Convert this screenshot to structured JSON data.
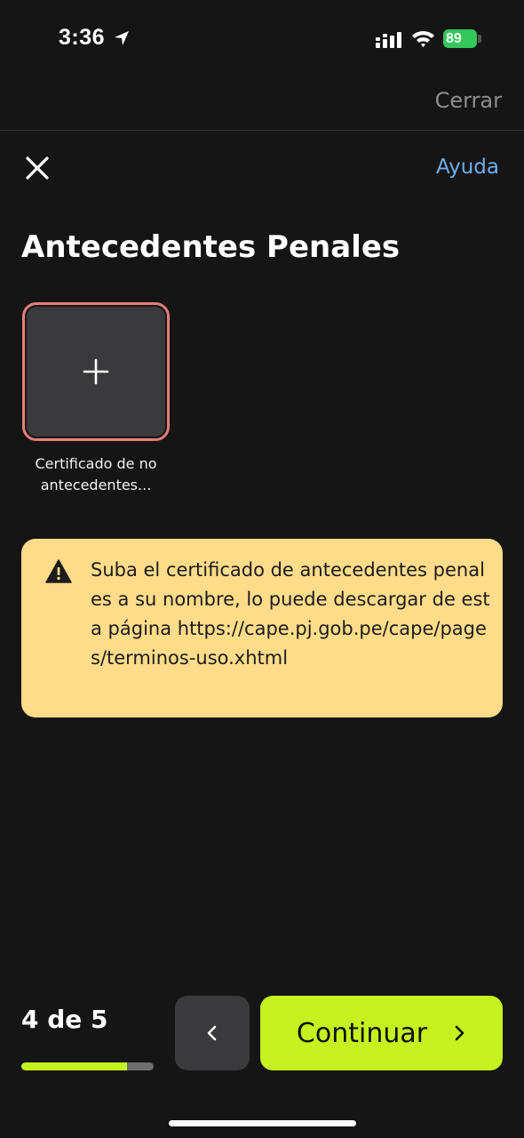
{
  "status_bar": {
    "time": "3:36",
    "battery_level": "89",
    "battery_color": "#34c759",
    "icons": [
      "location-arrow-icon",
      "signal-icon",
      "wifi-icon",
      "battery-icon"
    ]
  },
  "header": {
    "close_label": "Cerrar"
  },
  "nav": {
    "dismiss_icon": "x-icon",
    "help_label": "Ayuda",
    "help_color": "#6eaee8"
  },
  "page": {
    "title": "Antecedentes Penales"
  },
  "upload": {
    "icon": "plus-icon",
    "caption_line1": "Certificado de no",
    "caption_line2": "antecedentes...",
    "border_color": "#e97d7d"
  },
  "warning": {
    "icon": "warning-triangle-icon",
    "message": "Suba el certificado de antecedentes penales a su nombre, lo puede descargar de esta página https://cape.pj.gob.pe/cape/pages/terminos-uso.xhtml",
    "background": "#ffdc8a"
  },
  "footer": {
    "step_label": "4 de 5",
    "progress": 0.8,
    "accent_color": "#c5f11e",
    "back_icon": "chevron-left-icon",
    "continue_label": "Continuar",
    "continue_icon": "chevron-right-icon"
  }
}
